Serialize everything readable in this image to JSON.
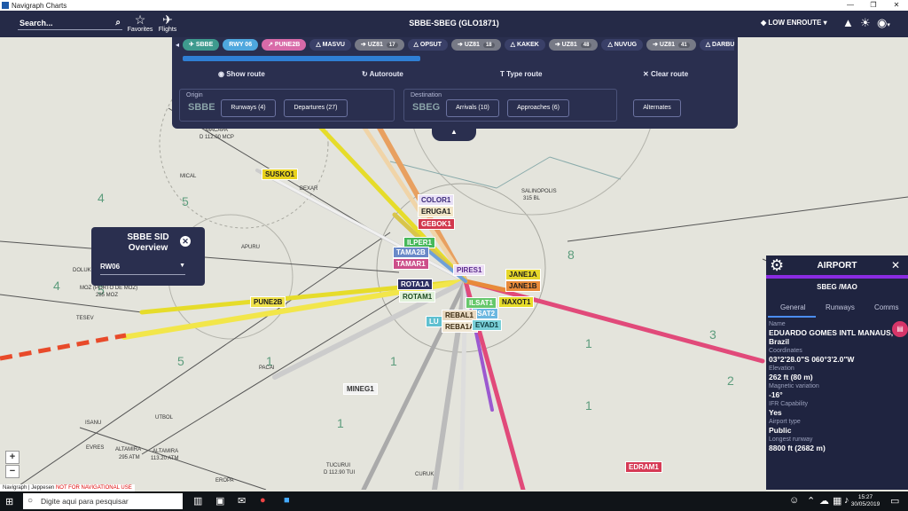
{
  "window": {
    "title": "Navigraph Charts",
    "controls": [
      "—",
      "❐",
      "✕"
    ]
  },
  "header": {
    "search_label": "Search...",
    "favorites_label": "Favorites",
    "flights_label": "Flights",
    "route_title": "SBBE-SBEG (GLO1871)",
    "layer_label": "LOW ENROUTE"
  },
  "route_panel": {
    "chips": [
      {
        "label": "SBBE",
        "color": "#3e9a8e",
        "icon": "plane-icon"
      },
      {
        "label": "RWY 06",
        "color": "#4ea7dd",
        "icon": ""
      },
      {
        "label": "PUNE2B",
        "color": "#d86aa8",
        "icon": "departure-icon"
      },
      {
        "label": "MASVU",
        "color": "#3a4068",
        "icon": "triangle-icon"
      },
      {
        "label": "UZ81",
        "color": "#777a86",
        "icon": "arrow-icon",
        "badge": "17"
      },
      {
        "label": "OPSUT",
        "color": "#3a4068",
        "icon": "triangle-icon"
      },
      {
        "label": "UZ81",
        "color": "#777a86",
        "icon": "arrow-icon",
        "badge": "18"
      },
      {
        "label": "KAKEK",
        "color": "#3a4068",
        "icon": "triangle-icon"
      },
      {
        "label": "UZ81",
        "color": "#777a86",
        "icon": "arrow-icon",
        "badge": "48"
      },
      {
        "label": "NUVUG",
        "color": "#3a4068",
        "icon": "triangle-icon"
      },
      {
        "label": "UZ81",
        "color": "#777a86",
        "icon": "arrow-icon",
        "badge": "41"
      },
      {
        "label": "DARBU",
        "color": "#3a4068",
        "icon": "triangle-icon"
      }
    ],
    "progress": 0.42,
    "actions": {
      "show_route": "Show route",
      "autoroute": "Autoroute",
      "type_route": "Type route",
      "clear_route": "Clear route"
    },
    "origin": {
      "caption": "Origin",
      "code": "SBBE",
      "runways": "Runways (4)",
      "departures": "Departures (27)"
    },
    "destination": {
      "caption": "Destination",
      "code": "SBEG",
      "arrivals": "Arrivals (10)",
      "approaches": "Approaches (6)"
    },
    "alternates": "Alternates"
  },
  "sid_overview": {
    "title": "SBBE SID Overview",
    "runway": "RW06"
  },
  "map": {
    "fixes": [
      {
        "label": "SUSKO1",
        "bg": "#e8d21c",
        "fg": "#1c1c1c"
      },
      {
        "label": "COLOR1",
        "bg": "#e8e0f6",
        "fg": "#3b2a79"
      },
      {
        "label": "ERUGA1",
        "bg": "#f2e6c8",
        "fg": "#1c1c1c"
      },
      {
        "label": "GEBOK1",
        "bg": "#d2384d",
        "fg": "#ffffff"
      },
      {
        "label": "ILPER1",
        "bg": "#46b85a",
        "fg": "#ffffff"
      },
      {
        "label": "TAMA2B",
        "bg": "#6a89c8",
        "fg": "#ffffff"
      },
      {
        "label": "TAMAR1",
        "bg": "#cc4f8a",
        "fg": "#ffffff"
      },
      {
        "label": "PIRES1",
        "bg": "#ecddf5",
        "fg": "#5a2a8c"
      },
      {
        "label": "ROTA1A",
        "bg": "#2d2f63",
        "fg": "#ffffff"
      },
      {
        "label": "ROTAM1",
        "bg": "#e0f2da",
        "fg": "#1c4a20"
      },
      {
        "label": "JANE1A",
        "bg": "#e6d72a",
        "fg": "#1c1c1c"
      },
      {
        "label": "JANE1B",
        "bg": "#e88a3a",
        "fg": "#1c1c1c"
      },
      {
        "label": "NAXOT1",
        "bg": "#e6dc2a",
        "fg": "#1c1c1c"
      },
      {
        "label": "ILSAT1",
        "bg": "#66c76b",
        "fg": "#ffffff"
      },
      {
        "label": "ISAT2",
        "bg": "#6bb7e0",
        "fg": "#ffffff"
      },
      {
        "label": "REBAL1",
        "bg": "#e8d8c0",
        "fg": "#3a2a10"
      },
      {
        "label": "REBA1A",
        "bg": "#f0e6d2",
        "fg": "#3a2a10"
      },
      {
        "label": "EVAD1",
        "bg": "#7ad0d8",
        "fg": "#0f3c40"
      },
      {
        "label": "LU",
        "bg": "#5fc0d0",
        "fg": "#ffffff"
      },
      {
        "label": "PUNE2B",
        "bg": "#efe14a",
        "fg": "#1c1c1c"
      },
      {
        "label": "MINEG1",
        "bg": "#f2f2f2",
        "fg": "#333333"
      },
      {
        "label": "EDRAM1",
        "bg": "#d63a55",
        "fg": "#ffffff"
      }
    ],
    "place_labels": [
      "MACAPA",
      "D 112.00 MCP",
      "MICAL",
      "BEXAR",
      "APURU",
      "DOLUK",
      "MOZ (PORTO DE MOZ)",
      "285 MOZ",
      "TESEV",
      "PACAI",
      "UTBOL",
      "ISANU",
      "EVRES",
      "ALTAMIRA",
      "295 ATM",
      "ALTAMIRA",
      "113.20 ATM",
      "TUCURUI",
      "D 112.90 TUI",
      "EROPA",
      "CURUK",
      "SALINOPOLIS",
      "315 BL"
    ]
  },
  "airport_panel": {
    "title": "AIRPORT",
    "code": "SBEG /MAO",
    "tabs": [
      "General",
      "Runways",
      "Comms"
    ],
    "fields": [
      {
        "label": "Name",
        "value": "EDUARDO GOMES INTL MANAUS, Brazil"
      },
      {
        "label": "Coordinates",
        "value": "03°2'28.0\"S  060°3'2.0\"W"
      },
      {
        "label": "Elevation",
        "value": "262 ft (80 m)"
      },
      {
        "label": "Magnetic variation",
        "value": "-16°"
      },
      {
        "label": "IFR Capability",
        "value": "Yes"
      },
      {
        "label": "Airport type",
        "value": "Public"
      },
      {
        "label": "Longest runway",
        "value": "8800 ft (2682 m)"
      }
    ]
  },
  "zoom": {
    "in": "+",
    "out": "−"
  },
  "copyright": {
    "credit": "Navigraph | Jeppesen",
    "warning": "NOT FOR NAVIGATIONAL USE"
  },
  "taskbar": {
    "search_placeholder": "Digite aqui para pesquisar",
    "time": "15:27",
    "date": "30/05/2019"
  }
}
